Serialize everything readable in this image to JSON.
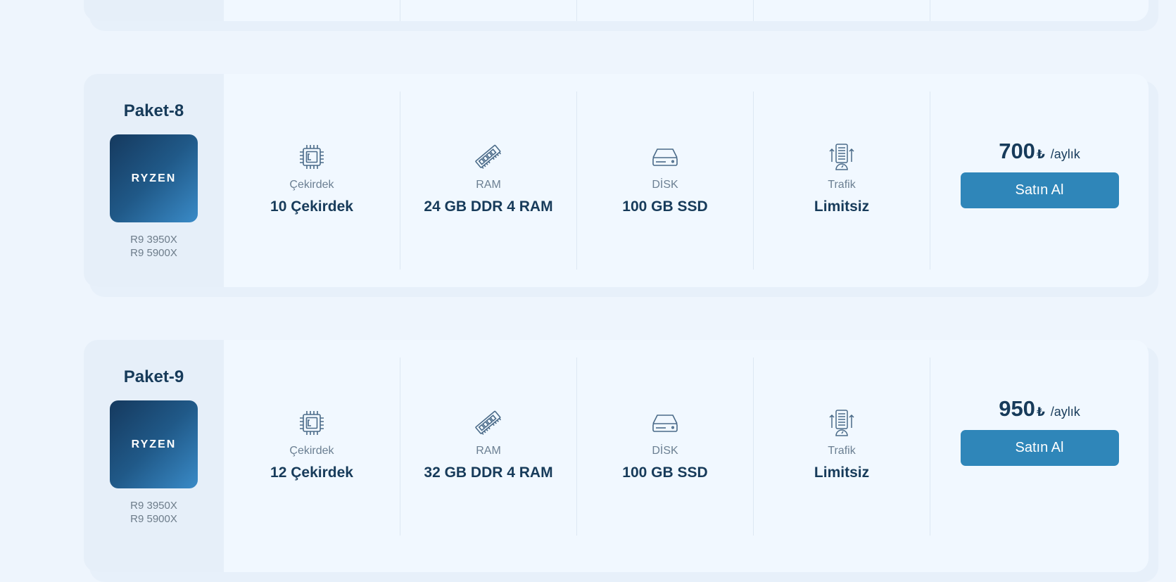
{
  "packages": [
    {
      "name": "",
      "models": [
        "",
        ""
      ],
      "cpu_label": "",
      "cpu_value": "",
      "ram_label": "",
      "ram_value": "",
      "disk_label": "",
      "disk_value": "",
      "traffic_label": "",
      "traffic_value": "",
      "price": "",
      "currency": "",
      "period": "",
      "buy_label": ""
    },
    {
      "name": "Paket-8",
      "logo_text": "RYZEN",
      "models": [
        "R9 3950X",
        "R9 5900X"
      ],
      "cpu_label": "Çekirdek",
      "cpu_value": "10 Çekirdek",
      "ram_label": "RAM",
      "ram_value": "24 GB DDR 4 RAM",
      "disk_label": "DİSK",
      "disk_value": "100 GB SSD",
      "traffic_label": "Trafik",
      "traffic_value": "Limitsiz",
      "price": "700",
      "currency": "₺",
      "period": "/aylık",
      "buy_label": "Satın Al"
    },
    {
      "name": "Paket-9",
      "logo_text": "RYZEN",
      "models": [
        "R9 3950X",
        "R9 5900X"
      ],
      "cpu_label": "Çekirdek",
      "cpu_value": "12 Çekirdek",
      "ram_label": "RAM",
      "ram_value": "32 GB DDR 4 RAM",
      "disk_label": "DİSK",
      "disk_value": "100 GB SSD",
      "traffic_label": "Trafik",
      "traffic_value": "Limitsiz",
      "price": "950",
      "currency": "₺",
      "period": "/aylık",
      "buy_label": "Satın Al"
    }
  ],
  "icons": {
    "cpu": "cpu-chip-icon",
    "ram": "ram-module-icon",
    "disk": "hard-drive-icon",
    "traffic": "server-traffic-icon"
  },
  "colors": {
    "page_bg": "#eef5fd",
    "card_bg": "#f1f8ff",
    "left_panel_bg": "#e6eff9",
    "heading": "#173b5a",
    "muted": "#6b7f92",
    "button": "#2f86b9",
    "icon_stroke": "#4a6a88"
  }
}
